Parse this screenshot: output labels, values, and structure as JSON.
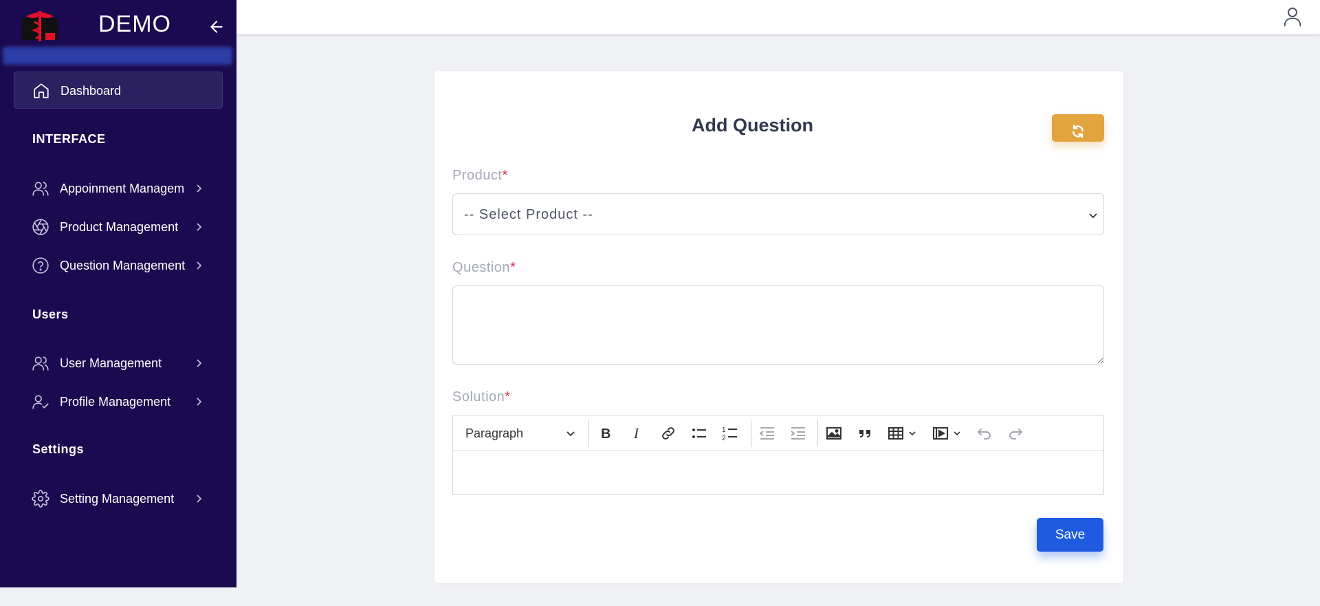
{
  "sidebar": {
    "brand_title": "DEMO",
    "dashboard_label": "Dashboard",
    "sections": {
      "interface": "INTERFACE",
      "users": "Users",
      "settings": "Settings"
    },
    "items": [
      {
        "label": "Appoinment Managem",
        "icon": "users-icon"
      },
      {
        "label": "Product Management",
        "icon": "aperture-icon"
      },
      {
        "label": "Question Management",
        "icon": "help-circle-icon"
      },
      {
        "label": "User Management",
        "icon": "users-icon"
      },
      {
        "label": "Profile Management",
        "icon": "user-check-icon"
      },
      {
        "label": "Setting Management",
        "icon": "gear-icon"
      }
    ]
  },
  "form": {
    "title": "Add Question",
    "product_label": "Product",
    "product_value": "-- Select Product --",
    "question_label": "Question",
    "question_value": "",
    "solution_label": "Solution",
    "required_mark": "*",
    "editor": {
      "paragraph_style": "Paragraph",
      "tools": [
        "bold-icon",
        "italic-icon",
        "link-icon",
        "bulleted-list-icon",
        "numbered-list-icon",
        "outdent-icon",
        "indent-icon",
        "image-icon",
        "quote-icon",
        "table-icon",
        "media-icon",
        "undo-icon",
        "redo-icon"
      ]
    },
    "save_label": "Save"
  },
  "colors": {
    "sidebar_bg": "#1b0a4f",
    "accent_refresh": "#e3a33e",
    "primary": "#1f5be0",
    "required": "#e0324b"
  }
}
